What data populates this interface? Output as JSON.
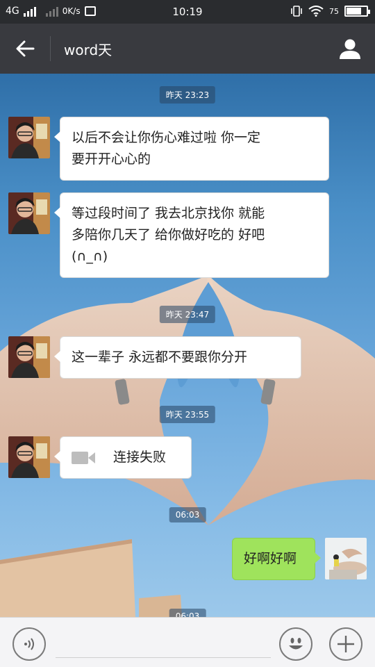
{
  "status_bar": {
    "network": "4G",
    "speed": "0K/s",
    "time": "10:19",
    "battery_text": "75",
    "battery_level": 0.75
  },
  "header": {
    "title": "word天",
    "back_icon": "arrow-left-icon",
    "profile_icon": "person-icon"
  },
  "messages": [
    {
      "time": "昨天 23:23"
    },
    {
      "sender": "other",
      "text_lines": [
        "以后不会让你伤心难过啦 你一定",
        "要开开心心的"
      ]
    },
    {
      "sender": "other",
      "text_lines": [
        "等过段时间了 我去北京找你 就能",
        "多陪你几天了 给你做好吃的 好吧",
        "(∩_∩)"
      ]
    },
    {
      "time": "昨天 23:47"
    },
    {
      "sender": "other",
      "text_lines": [
        "这一辈子 永远都不要跟你分开"
      ]
    },
    {
      "time": "昨天 23:55"
    },
    {
      "sender": "other",
      "type": "video_call",
      "text": "连接失败",
      "icon": "video-camera-icon"
    },
    {
      "time": "06:03"
    },
    {
      "sender": "me",
      "text": "好啊好啊"
    },
    {
      "time": "06:03"
    }
  ],
  "input_bar": {
    "voice_icon": "voice-icon",
    "emoji_icon": "smiley-icon",
    "plus_icon": "plus-icon",
    "placeholder": ""
  },
  "colors": {
    "titlebar": "#393a3f",
    "statusbar": "#2a2c2f",
    "my_bubble": "#9fe35c",
    "other_bubble": "#ffffff"
  }
}
